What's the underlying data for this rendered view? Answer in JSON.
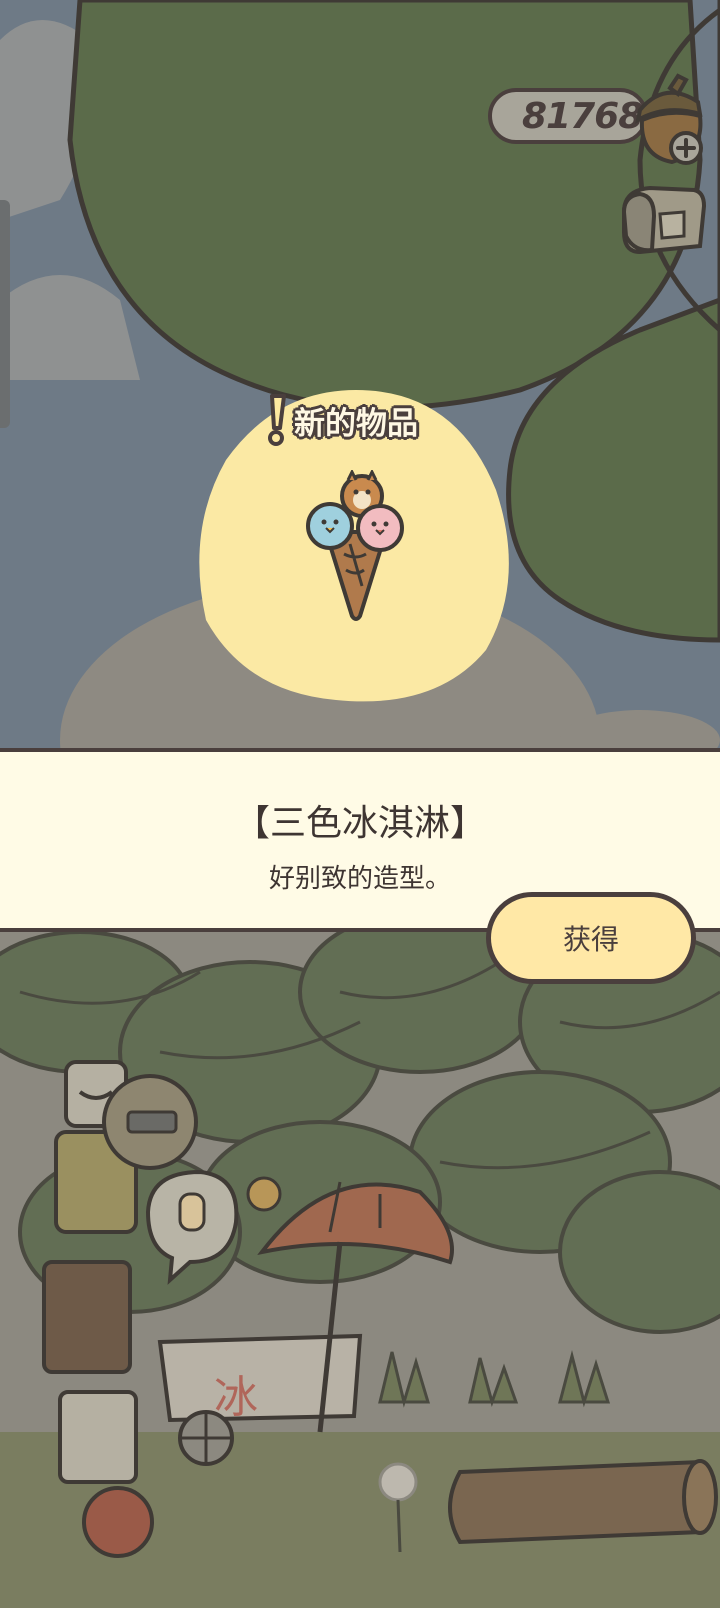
{
  "hud": {
    "acorn_count": "81768",
    "acorn_icon": "acorn-icon",
    "add_icon": "plus-icon",
    "mailbox_icon": "mailbox-icon"
  },
  "new_item": {
    "label": "新的物品",
    "icon": "ice-cream-icon"
  },
  "item_panel": {
    "name": "【三色冰淇淋】",
    "description": "好别致的造型。"
  },
  "actions": {
    "obtain_label": "获得"
  },
  "scene": {
    "cart_sign": "冰"
  },
  "colors": {
    "outline": "#4a3f3d",
    "panel_bg": "#fffbe6",
    "button_bg": "#ffe8a6",
    "glow": "#fbe9a4"
  }
}
